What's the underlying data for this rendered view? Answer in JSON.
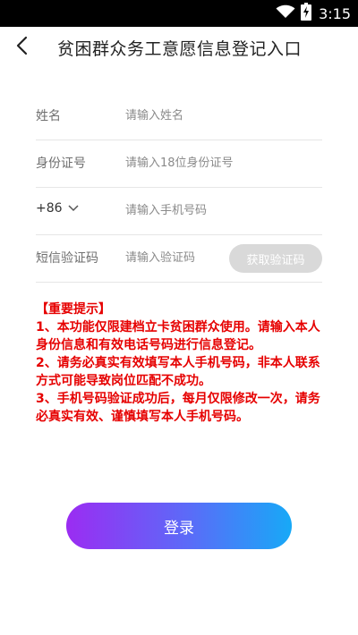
{
  "status_bar": {
    "time": "3:15",
    "icons": [
      "wifi-icon",
      "battery-charging-icon"
    ]
  },
  "header": {
    "title": "贫困群众务工意愿信息登记入口",
    "back_icon": "chevron-left-icon"
  },
  "form": {
    "name": {
      "label": "姓名",
      "placeholder": "请输入姓名",
      "value": ""
    },
    "id_card": {
      "label": "身份证号",
      "placeholder": "请输入18位身份证号",
      "value": ""
    },
    "phone": {
      "country_code": "+86",
      "placeholder": "请输入手机号码",
      "value": ""
    },
    "sms_code": {
      "label": "短信验证码",
      "placeholder": "请输入验证码",
      "value": "",
      "button_label": "获取验证码"
    }
  },
  "notice": {
    "title": "【重要提示】",
    "items": [
      "1、本功能仅限建档立卡贫困群众使用。请输入本人身份信息和有效电话号码进行信息登记。",
      "2、请务必真实有效填写本人手机号码，非本人联系方式可能导致岗位匹配不成功。",
      "3、手机号码验证成功后，每月仅限修改一次，请务必真实有效、谨慎填写本人手机号码。"
    ]
  },
  "login_button": {
    "label": "登录"
  },
  "colors": {
    "notice_text": "#e60000",
    "gradient_start": "#9b2cf2",
    "gradient_end": "#17a9f7",
    "disabled_button": "#d9d9d9"
  }
}
